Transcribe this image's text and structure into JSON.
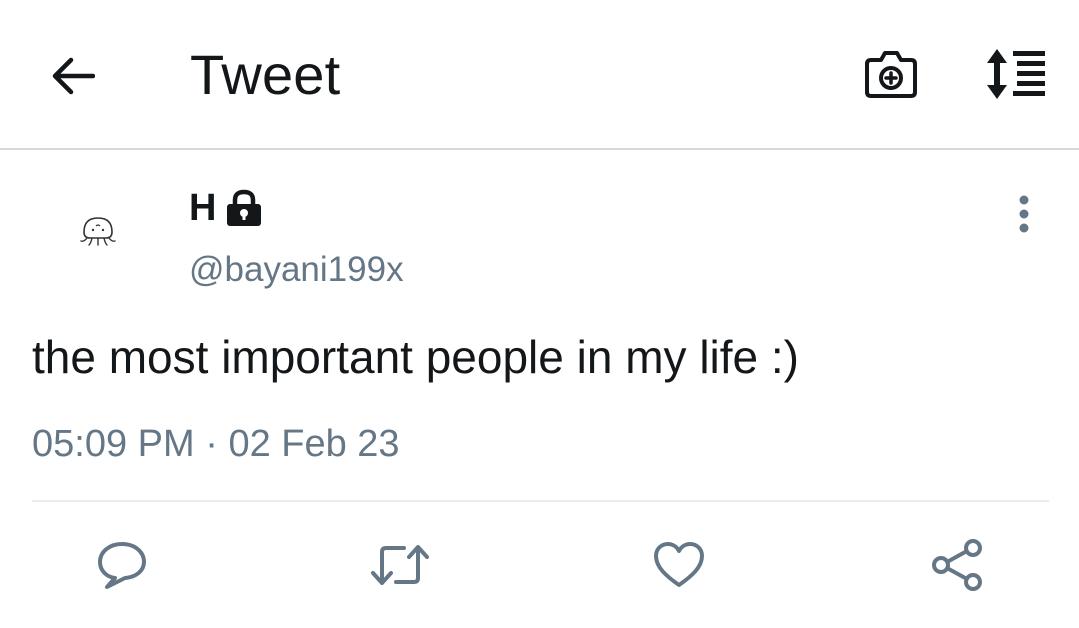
{
  "header": {
    "title": "Tweet"
  },
  "icons": {
    "back": "arrow-left-icon",
    "camera": "camera-plus-icon",
    "sort": "sort-list-icon",
    "lock": "lock-icon",
    "more": "more-vertical-icon",
    "reply": "reply-icon",
    "retweet": "retweet-icon",
    "like": "heart-icon",
    "share": "share-icon"
  },
  "tweet": {
    "display_name": "H",
    "handle": "@bayani199x",
    "text": "the most important people in my life :)",
    "time": "05:09 PM",
    "separator": " · ",
    "date": "02 Feb 23"
  },
  "colors": {
    "primary_text": "#14171a",
    "secondary_text": "#657786",
    "icon_gray": "#657786",
    "divider": "#e6ecf0"
  }
}
